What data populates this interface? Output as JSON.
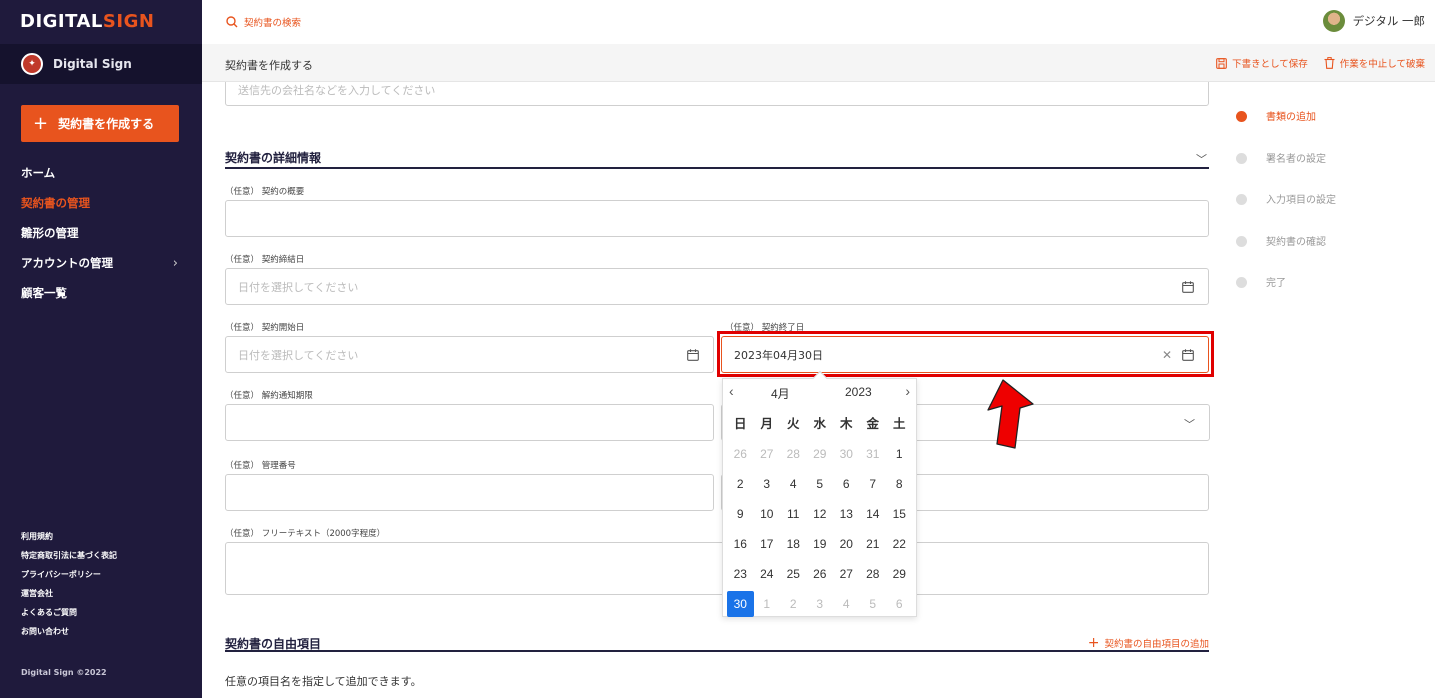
{
  "app": {
    "logo_left": "DIGITAL",
    "logo_right": "SIGN",
    "org_name": "Digital Sign"
  },
  "sidebar": {
    "create_button": "契約書を作成する",
    "items": [
      {
        "label": "ホーム"
      },
      {
        "label": "契約書の管理"
      },
      {
        "label": "雛形の管理"
      },
      {
        "label": "アカウントの管理"
      },
      {
        "label": "顧客一覧"
      }
    ],
    "footer_links": [
      "利用規約",
      "特定商取引法に基づく表記",
      "プライバシーポリシー",
      "運営会社",
      "よくあるご質問",
      "お問い合わせ"
    ],
    "copyright": "Digital Sign ©2022"
  },
  "header": {
    "search_label": "契約書の検索",
    "user_name": "デジタル 一郎"
  },
  "subbar": {
    "title": "契約書を作成する",
    "save_draft": "下書きとして保存",
    "discard": "作業を中止して破棄"
  },
  "form": {
    "recipient_placeholder": "送信先の会社名などを入力してください",
    "details_title": "契約書の詳細情報",
    "overview_label": "（任意） 契約の概要",
    "signing_date_label": "（任意） 契約締結日",
    "date_placeholder": "日付を選択してください",
    "start_date_label": "（任意） 契約開始日",
    "end_date_label": "（任意） 契約終了日",
    "end_date_value": "2023年04月30日",
    "notice_label": "（任意） 解約通知期限",
    "mgmt_label": "（任意） 管理番号",
    "free_text_label": "（任意） フリーテキスト（2000字程度）",
    "free_items_title": "契約書の自由項目",
    "add_free_item": "契約書の自由項目の追加",
    "free_items_hint": "任意の項目名を指定して追加できます。"
  },
  "calendar": {
    "month": "4月",
    "year": "2023",
    "weekdays": [
      "日",
      "月",
      "火",
      "水",
      "木",
      "金",
      "土"
    ],
    "weeks": [
      [
        "26",
        "27",
        "28",
        "29",
        "30",
        "31",
        "1"
      ],
      [
        "2",
        "3",
        "4",
        "5",
        "6",
        "7",
        "8"
      ],
      [
        "9",
        "10",
        "11",
        "12",
        "13",
        "14",
        "15"
      ],
      [
        "16",
        "17",
        "18",
        "19",
        "20",
        "21",
        "22"
      ],
      [
        "23",
        "24",
        "25",
        "26",
        "27",
        "28",
        "29"
      ],
      [
        "30",
        "1",
        "2",
        "3",
        "4",
        "5",
        "6"
      ]
    ],
    "selected": "30"
  },
  "steps": [
    {
      "label": "書類の追加",
      "active": true
    },
    {
      "label": "署名者の設定",
      "active": false
    },
    {
      "label": "入力項目の設定",
      "active": false
    },
    {
      "label": "契約書の確認",
      "active": false
    },
    {
      "label": "完了",
      "active": false
    }
  ],
  "colors": {
    "accent": "#e8541e",
    "sidebar": "#1f1a3c",
    "selected_day": "#1a73e8",
    "annotation": "#e00000"
  }
}
